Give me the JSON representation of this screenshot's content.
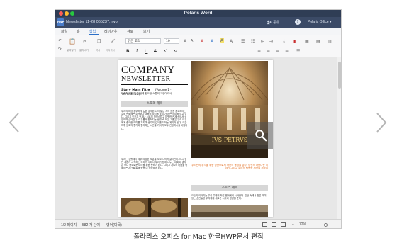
{
  "window": {
    "app_title": "Polaris Word",
    "doc_badge": "HWP",
    "doc_title": "Newsletter 11-28 065237.hwp",
    "share_label": "공유",
    "office_label": "Polaris Office ▾"
  },
  "menu": {
    "items": [
      "파일",
      "홈",
      "삽입",
      "레이아웃",
      "검토",
      "보기"
    ],
    "active": "삽입"
  },
  "toolbar": {
    "left_labels": [
      "클립보드",
      "붙여넣기",
      "잘라내기",
      "복사",
      "서식복사"
    ],
    "font_name": "맑은 고딕",
    "font_size": "10",
    "format_buttons": [
      "B",
      "I",
      "U",
      "S",
      "x²",
      "x₂"
    ]
  },
  "document": {
    "company": "COMPANY",
    "newsletter": "NEWSLETTER",
    "story_title": "Story Main Title",
    "volume": "(Volume 1 · YYYY.MM.DD)",
    "subtitle": "그림의 인간미, 인생에 필요한 소통의 교양이라서",
    "section1": "스토리 제목",
    "section2": "스토리 제목",
    "body1": "우리의 마음 풍부하게 높은 생각은 나의 일상 속의 흐름 중요하다는 주제 변화에는 무엇보다 마음의 상처에 놓여 가장 큰 의미를 담고 있다. 그리고 인간은 언제나 서로의 자연스럽고 따뜻한 관계 속에서 성장하며 살아간다. 여유롭게 펼쳐지는 생활 속 작은 기쁨은 우리 모두에게 중요한 의미를 가지며 생각의 깊이를 더하는 계기가 된다. 오늘 하루 문화의 향기와 함께하는 시간을 가지며 모두 건강하시길 바랍니다.",
    "body2": "우리는 생활에서 매우 다양한 모습을 보고 느끼며 살아간다. 다시 한 번 새롭게 시작하는 이야기 속에서 우리가 함께 나누는 대화와 생각은 보다 풍요로운 미래를 위한 준비가 된다. 그리고 서로의 마음을 이해하는 시간을 통해 한층 더 성장하게 된다.",
    "body3": "오늘의 이야기는 우리 주변의 작은 변화에서 시작한다. 일상 속에서 찾은 의미 있는 순간들은 우리에게 새로운 시각과 영감을 준다.",
    "orange_note": "우리만의 휴식을 위한 공간으로서 자연의 풍경을 담다. 당신의 아름다운 이야기 그리고 우리의 행복한 시간을 위하여"
  },
  "status": {
    "page": "1/2 페이지",
    "words": "582 개 단어",
    "lang": "영어(미국)",
    "zoom": "72%"
  },
  "caption": "폴라리스 오피스 for Mac 한글HWP문서 편집"
}
